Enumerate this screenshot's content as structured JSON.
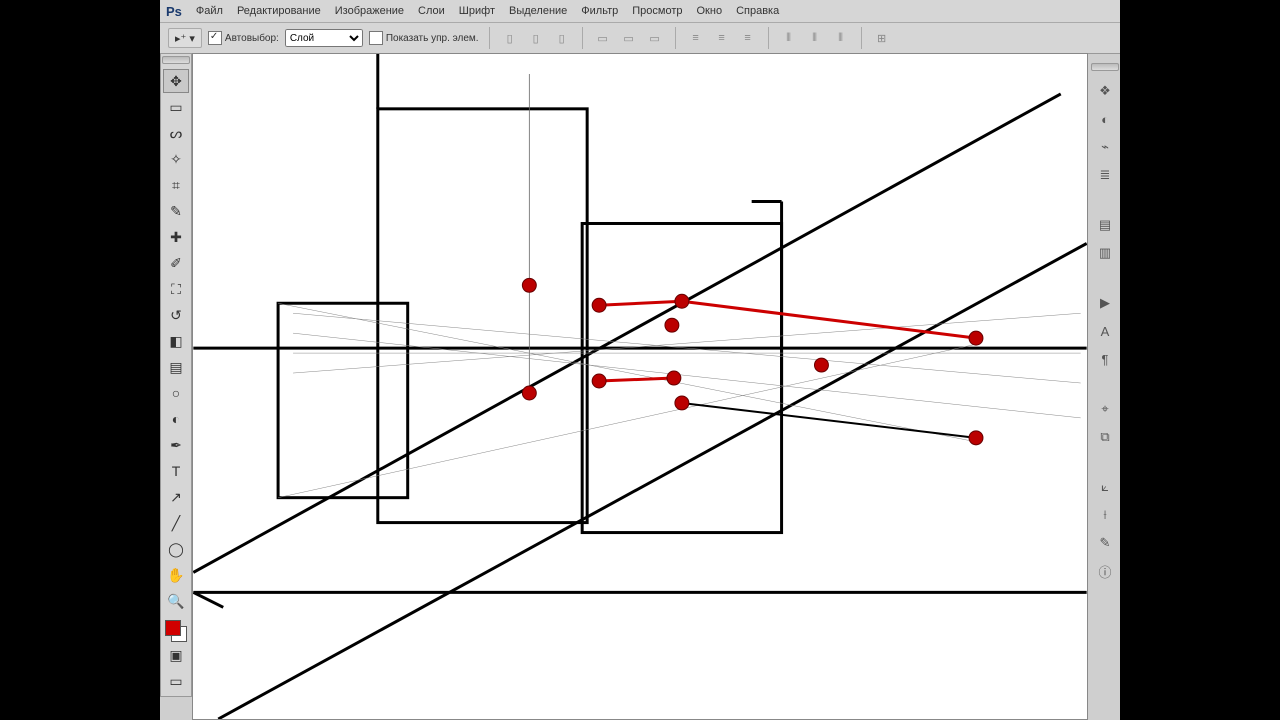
{
  "menu": {
    "items": [
      "Файл",
      "Редактирование",
      "Изображение",
      "Слои",
      "Шрифт",
      "Выделение",
      "Фильтр",
      "Просмотр",
      "Окно",
      "Справка"
    ]
  },
  "options": {
    "autosel_label": "Автовыбор:",
    "dropdown_value": "Слой",
    "show_controls_label": "Показать упр. элем."
  },
  "tools": {
    "names": [
      "move",
      "marquee",
      "lasso",
      "wand",
      "crop",
      "eyedrop",
      "heal",
      "brush",
      "stamp",
      "history",
      "eraser",
      "gradient",
      "blur",
      "dodge",
      "pen",
      "text",
      "path",
      "line",
      "shape",
      "hand",
      "zoom"
    ]
  },
  "swatches": {
    "fg": "#d10000",
    "bg": "#ffffff"
  },
  "panels": {
    "names": [
      "layers",
      "channels",
      "paths",
      "history",
      "swatches",
      "styles",
      "play",
      "character",
      "paragraph",
      "brushes",
      "clone",
      "3d",
      "measure",
      "notes",
      "info"
    ]
  }
}
